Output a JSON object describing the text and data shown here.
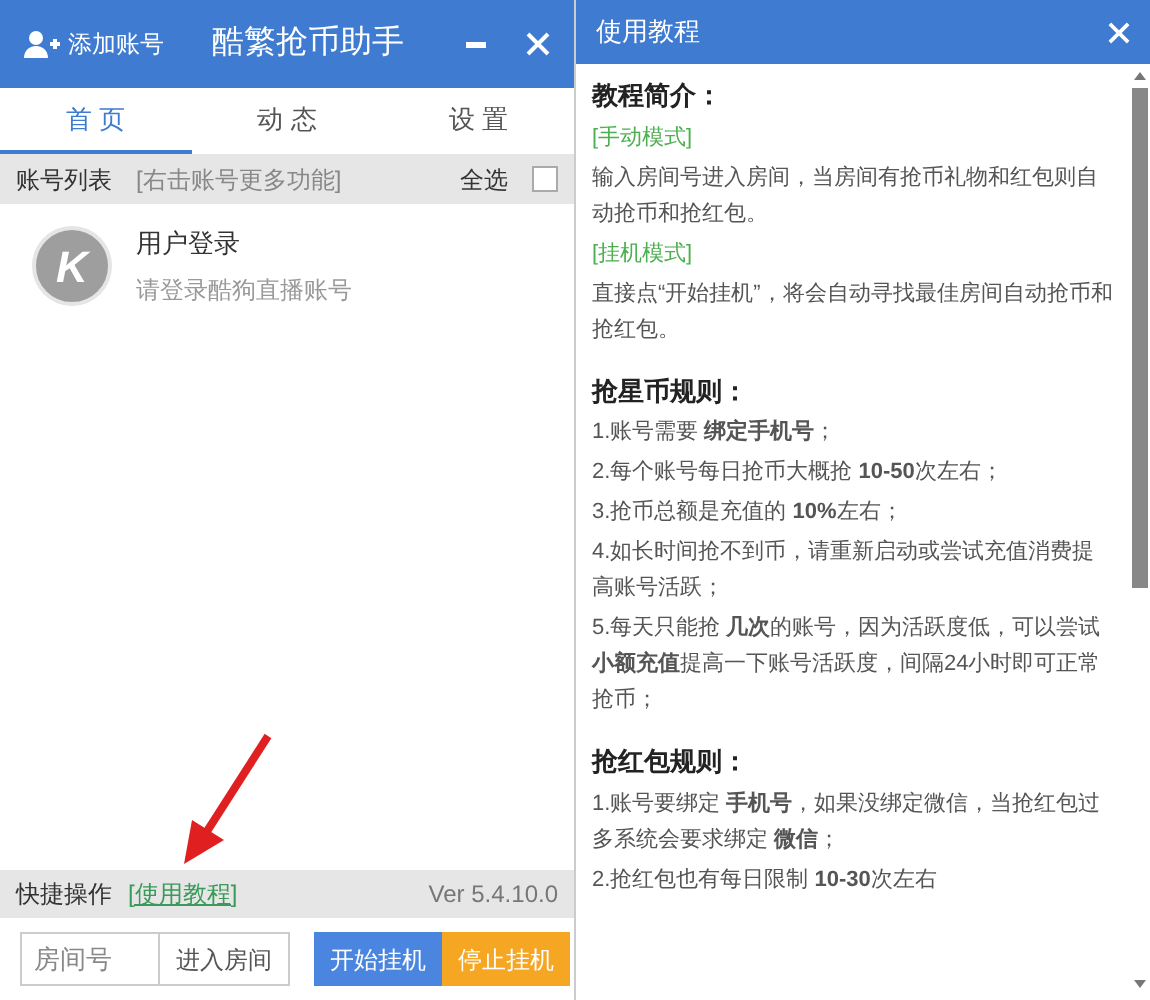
{
  "main_window": {
    "add_account": "添加账号",
    "title": "酷繁抢币助手",
    "tabs": [
      {
        "label": "首 页",
        "selected": true
      },
      {
        "label": "动 态",
        "selected": false
      },
      {
        "label": "设 置",
        "selected": false
      }
    ],
    "list_header": {
      "label": "账号列表",
      "hint": "[右击账号更多功能]",
      "select_all": "全选",
      "select_all_checked": false
    },
    "accounts": [
      {
        "avatar_letter": "K",
        "name": "用户登录",
        "subtitle": "请登录酷狗直播账号"
      }
    ],
    "footer": {
      "label": "快捷操作",
      "link": "[使用教程]",
      "version": "Ver 5.4.10.0"
    },
    "room_input": {
      "placeholder": "房间号"
    },
    "buttons": [
      {
        "label": "进入房间",
        "kind": "plain"
      },
      {
        "label": "开始挂机",
        "kind": "primary"
      },
      {
        "label": "停止挂机",
        "kind": "warning"
      }
    ]
  },
  "tutorial": {
    "title": "使用教程",
    "sections": [
      {
        "heading": "教程简介：",
        "paragraphs": [
          {
            "kind": "mode",
            "text": "[手动模式]"
          },
          {
            "kind": "text",
            "text": "输入房间号进入房间，当房间有抢币礼物和红包则自动抢币和抢红包。"
          },
          {
            "kind": "mode",
            "text": "[挂机模式]"
          },
          {
            "kind": "text",
            "text": "直接点“开始挂机”，将会自动寻找最佳房间自动抢币和抢红包。"
          }
        ]
      },
      {
        "heading": "抢星币规则：",
        "paragraphs": [
          {
            "kind": "text",
            "text": "1.账号需要 **绑定手机号**；"
          },
          {
            "kind": "text",
            "text": "2.每个账号每日抢币大概抢 **10-50**次左右；"
          },
          {
            "kind": "text",
            "text": "3.抢币总额是充值的 **10%**左右；"
          },
          {
            "kind": "text",
            "text": "4.如长时间抢不到币，请重新启动或尝试充值消费提高账号活跃；"
          },
          {
            "kind": "text",
            "text": "5.每天只能抢 **几次**的账号，因为活跃度低，可以尝试**小额充值**提高一下账号活跃度，间隔24小时即可正常抢币；"
          }
        ]
      },
      {
        "heading": "抢红包规则：",
        "paragraphs": [
          {
            "kind": "text",
            "text": "1.账号要绑定 **手机号**，如果没绑定微信，当抢红包过多系统会要求绑定 **微信**；"
          },
          {
            "kind": "text",
            "text": "2.抢红包也有每日限制 **10-30**次左右"
          }
        ]
      }
    ]
  }
}
